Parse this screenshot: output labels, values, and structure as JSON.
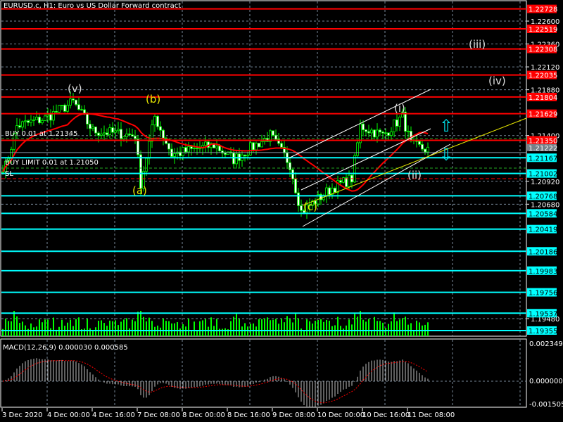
{
  "header": {
    "title": "EURUSD.c, H1:  Euro vs US Dollar Forward contract"
  },
  "orders": {
    "buy": "BUY 0.01 at 1.21345",
    "buy_limit": "BUY LIMIT 0.01 at 1.21050",
    "sl": "SL"
  },
  "waves": {
    "v": "(v)",
    "b": "(b)",
    "a": "(a)",
    "c": "(c)",
    "i": "(i)",
    "ii": "(ii)",
    "iii": "(iii)",
    "iv": "(iv)"
  },
  "colors": {
    "bull": "#00ff00",
    "red_line": "#ff0000",
    "cyan_line": "#00ffff",
    "ma": "#ff0000",
    "grid": "#778899"
  },
  "chart_data": {
    "type": "candlestick",
    "symbol": "EURUSD.c",
    "timeframe": "H1",
    "ylim": [
      1.1925,
      1.2285
    ],
    "price_ticks": [
      "1.22600",
      "1.22360",
      "1.22120",
      "1.21880",
      "1.21400",
      "1.20920",
      "1.20680",
      "1.19480"
    ],
    "red_levels": [
      "1.22728",
      "1.22519",
      "1.22308",
      "1.22035",
      "1.21804",
      "1.21629",
      "1.21350"
    ],
    "cyan_levels": [
      "1.21167",
      "1.21002",
      "1.20768",
      "1.20584",
      "1.20419",
      "1.20186",
      "1.19983",
      "1.19756",
      "1.19537",
      "1.19355"
    ],
    "current_price": "1.21222",
    "time_labels": [
      "3 Dec 2020",
      "4 Dec 00:00",
      "4 Dec 16:00",
      "7 Dec 08:00",
      "8 Dec 00:00",
      "8 Dec 16:00",
      "9 Dec 08:00",
      "10 Dec 00:00",
      "10 Dec 16:00",
      "11 Dec 08:00"
    ],
    "keypoints_bar_price": [
      [
        1,
        1.2108
      ],
      [
        5,
        1.215
      ],
      [
        15,
        1.2158
      ],
      [
        25,
        1.2175
      ],
      [
        32,
        1.2145
      ],
      [
        47,
        1.214
      ],
      [
        49,
        1.209
      ],
      [
        54,
        1.216
      ],
      [
        60,
        1.212
      ],
      [
        75,
        1.213
      ],
      [
        82,
        1.2115
      ],
      [
        95,
        1.214
      ],
      [
        102,
        1.211
      ],
      [
        106,
        1.206
      ],
      [
        117,
        1.2085
      ],
      [
        124,
        1.2095
      ],
      [
        127,
        1.215
      ],
      [
        135,
        1.214
      ],
      [
        142,
        1.216
      ],
      [
        145,
        1.213
      ],
      [
        151,
        1.2125
      ]
    ],
    "macd": {
      "label": "MACD(12,26,9) 0.000030 0.000585",
      "ticks": [
        "0.002349",
        "0.000000",
        "-0.001505"
      ]
    }
  }
}
